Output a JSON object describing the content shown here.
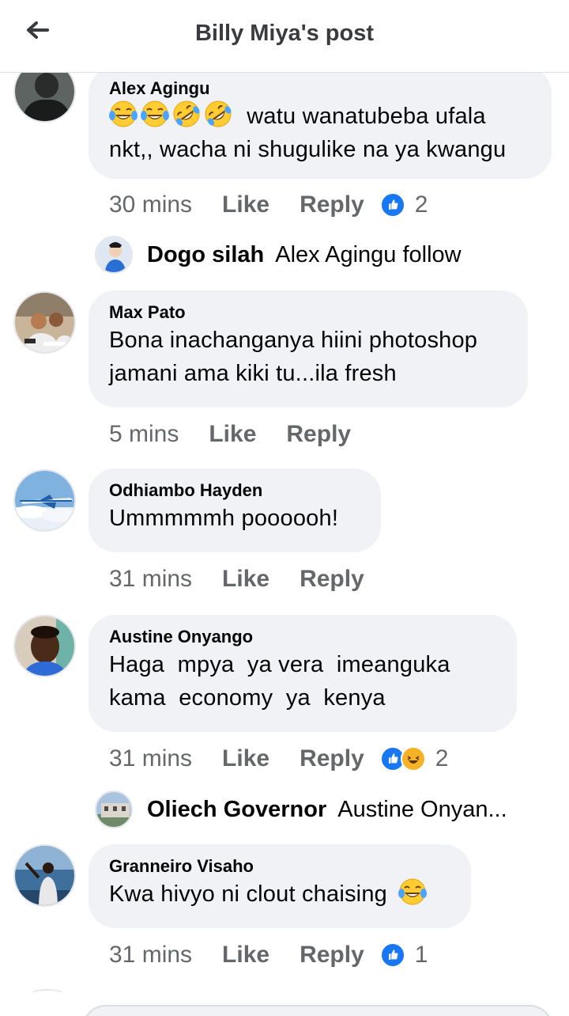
{
  "header": {
    "title": "Billy Miya's post"
  },
  "comments": [
    {
      "author": "Alex Agingu",
      "line1": "watu wanatubeba ufala",
      "line2": "nkt,, wacha ni shugulike na ya kwangu",
      "time": "30 mins",
      "like": "Like",
      "reply": "Reply",
      "reaction_count": "2",
      "reply_preview": {
        "author": "Dogo silah",
        "text": "Alex Agingu follow"
      }
    },
    {
      "author": "Max Pato",
      "line1": "Bona inachanganya hiini photoshop",
      "line2": "jamani ama kiki tu...ila fresh",
      "time": "5 mins",
      "like": "Like",
      "reply": "Reply"
    },
    {
      "author": "Odhiambo Hayden",
      "line1": "Ummmmmh poooooh!",
      "time": "31 mins",
      "like": "Like",
      "reply": "Reply"
    },
    {
      "author": "Austine Onyango",
      "line1": "Haga  mpya  ya vera  imeanguka",
      "line2": "kama  economy  ya  kenya",
      "time": "31 mins",
      "like": "Like",
      "reply": "Reply",
      "reaction_count": "2",
      "reply_preview": {
        "author": "Oliech Governor",
        "text": "Austine Onyan..."
      }
    },
    {
      "author": "Granneiro Visaho",
      "line1": "Kwa hivyo ni clout chaising",
      "time": "31 mins",
      "like": "Like",
      "reply": "Reply",
      "reaction_count": "1"
    }
  ],
  "colors": {
    "like_blue": "#1877f2",
    "bubble": "#f0f2f5",
    "meta_gray": "#65676b",
    "haha_yellow": "#f7b125"
  },
  "icons": [
    "back-arrow-icon",
    "like-reaction-icon",
    "haha-reaction-icon",
    "laughing-tears-emoji",
    "rolling-laughing-emoji"
  ]
}
